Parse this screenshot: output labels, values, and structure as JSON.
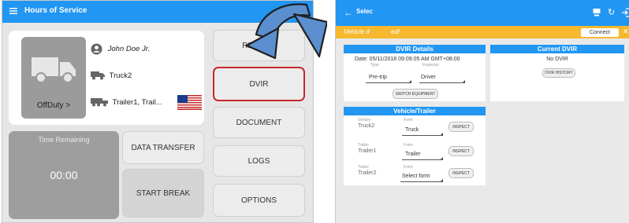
{
  "left": {
    "app_title": "Hours of Service",
    "driver_name": "John Doe Jr.",
    "vehicle": "Truck2",
    "trailers": "Trailer1, Trail...",
    "duty_status": "OffDuty",
    "duty_chevron": ">",
    "time_label": "Time Remaining",
    "time_value": "00:00",
    "buttons": {
      "remark": "REMARK",
      "dvir": "DVIR",
      "document": "DOCUMENT",
      "data_transfer": "DATA TRANSFER",
      "logs": "LOGS",
      "start_break": "START BREAK",
      "options": "OPTIONS"
    },
    "icons": [
      "menu-icon",
      "refresh-icon",
      "logout-icon",
      "truck-icon",
      "account-icon",
      "trailer-icon",
      "us-flag-icon"
    ]
  },
  "right": {
    "title_partial": "Selec",
    "notification_partial": "Vehicle d",
    "notification_partial_end": "ed!",
    "connect_label": "Connect",
    "dvir_details": {
      "header": "DVIR Details",
      "date": "Date: 05/11/2018 09:09:05 AM GMT+08:00",
      "type_label": "Type",
      "type_value": "Pre-trip",
      "inspector_label": "Inspector",
      "inspector_value": "Driver",
      "switch_equipment": "SWITCH EQUIPMENT"
    },
    "current_dvir": {
      "header": "Current DVIR",
      "no_dvir": "No DVIR",
      "history_button": "DVIR HISTORY"
    },
    "vehicle_trailer": {
      "header": "Vehicle/Trailer",
      "rows": [
        {
          "unit_label": "Vehicle",
          "unit": "Truck2",
          "form_label": "Form",
          "form": "Truck",
          "inspect": "INSPECT"
        },
        {
          "unit_label": "Trailer",
          "unit": "Trailer1",
          "form_label": "Form",
          "form": "Trailer",
          "inspect": "INSPECT"
        },
        {
          "unit_label": "Trailer",
          "unit": "Trailer2",
          "form_label": "Form",
          "form": "Select form",
          "inspect": "INSPECT"
        }
      ]
    }
  },
  "colors": {
    "primary": "#2196f3",
    "notification": "#f5b82e",
    "highlight": "#c62828",
    "arrow_fill": "#5b8fcf",
    "arrow_stroke": "#1f1f1f"
  }
}
